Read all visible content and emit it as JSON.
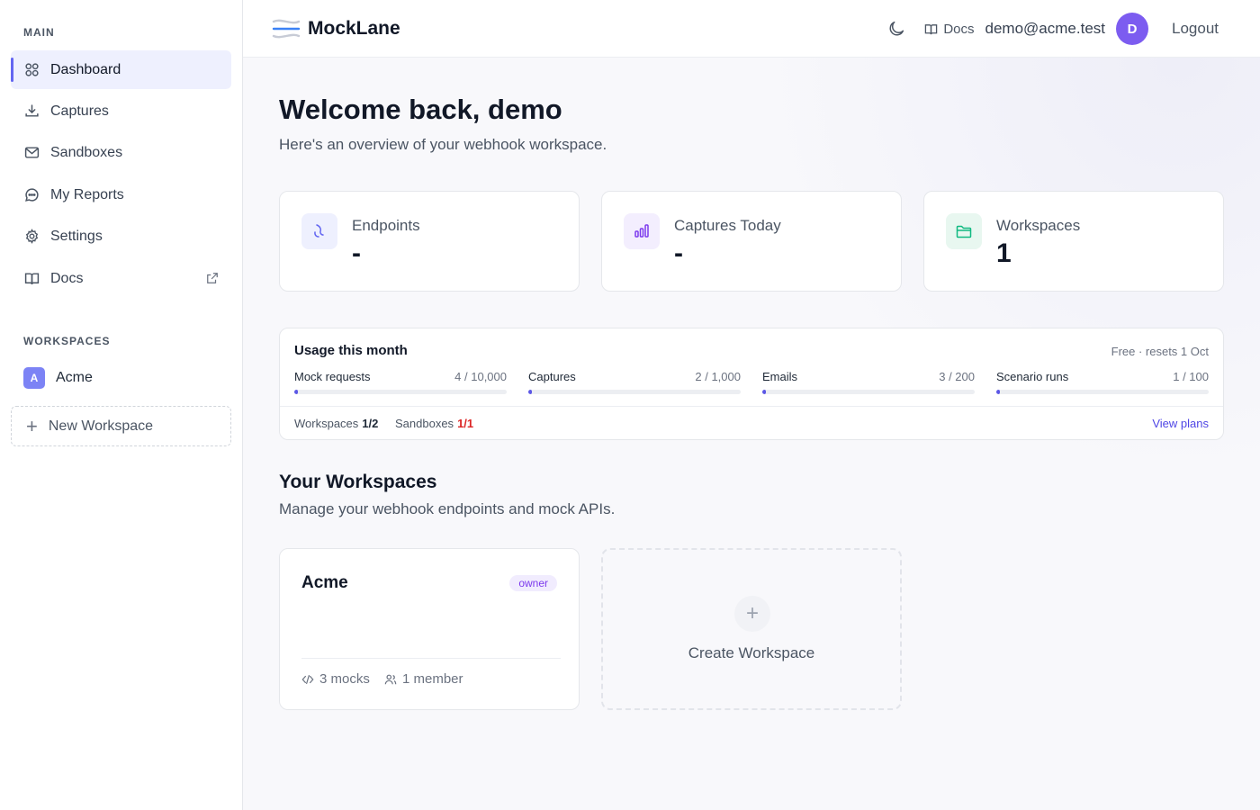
{
  "app": {
    "name": "MockLane"
  },
  "sidebar": {
    "main_label": "MAIN",
    "items": [
      {
        "label": "Dashboard",
        "icon": "grid-icon"
      },
      {
        "label": "Captures",
        "icon": "download-icon"
      },
      {
        "label": "Sandboxes",
        "icon": "mail-icon"
      },
      {
        "label": "My Reports",
        "icon": "chat-icon"
      },
      {
        "label": "Settings",
        "icon": "gear-icon"
      },
      {
        "label": "Docs",
        "icon": "book-icon"
      }
    ],
    "workspaces_label": "WORKSPACES",
    "workspace": {
      "initial": "A",
      "name": "Acme"
    },
    "new_workspace_label": "New Workspace"
  },
  "header": {
    "docs_label": "Docs",
    "email": "demo@acme.test",
    "avatar_initial": "D",
    "logout_label": "Logout"
  },
  "main": {
    "title": "Welcome back, demo",
    "subtitle": "Here's an overview of your webhook workspace.",
    "stats": [
      {
        "label": "Endpoints",
        "value": "-",
        "icon": "hook-icon",
        "color": "#6366f1"
      },
      {
        "label": "Captures Today",
        "value": "-",
        "icon": "bar-chart-icon",
        "color": "#7c3aed"
      },
      {
        "label": "Workspaces",
        "value": "1",
        "icon": "folder-icon",
        "color": "#10b981"
      }
    ],
    "usage": {
      "title": "Usage this month",
      "plan": "Free · resets 1 Oct",
      "meters": [
        {
          "name": "Mock requests",
          "value": "4 / 10,000",
          "fraction": 0.0004
        },
        {
          "name": "Captures",
          "value": "2 / 1,000",
          "fraction": 0.002
        },
        {
          "name": "Emails",
          "value": "3 / 200",
          "fraction": 0.015
        },
        {
          "name": "Scenario runs",
          "value": "1 / 100",
          "fraction": 0.01
        }
      ],
      "footer": {
        "workspaces_label": "Workspaces",
        "workspaces_value": "1/2",
        "sandboxes_label": "Sandboxes",
        "sandboxes_value": "1/1",
        "view_plans": "View plans"
      }
    },
    "section_title": "Your Workspaces",
    "section_subtitle": "Manage your webhook endpoints and mock APIs.",
    "workspace_card": {
      "name": "Acme",
      "role": "owner",
      "mocks": "3 mocks",
      "members": "1 member"
    },
    "create_label": "Create Workspace"
  }
}
